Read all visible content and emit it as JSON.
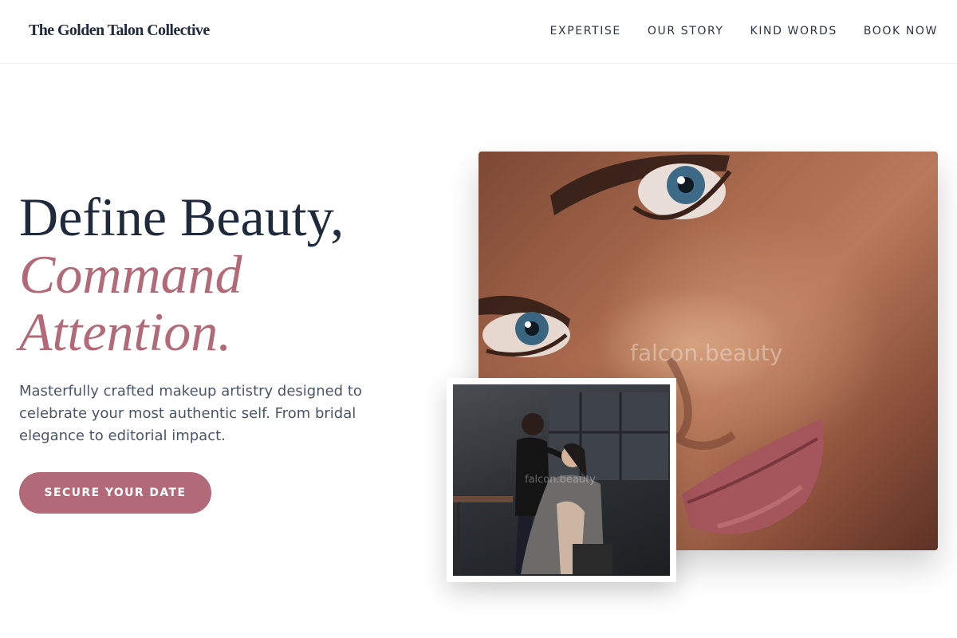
{
  "header": {
    "brand": "The Golden Talon Collective",
    "nav": [
      "EXPERTISE",
      "OUR STORY",
      "KIND WORDS",
      "BOOK NOW"
    ]
  },
  "hero": {
    "title_line1": "Define Beauty,",
    "title_line2": "Command",
    "title_line3": "Attention.",
    "subtitle": "Masterfully crafted makeup artistry designed to celebrate your most authentic self. From bridal elegance to editorial impact.",
    "cta_label": "SECURE YOUR DATE"
  },
  "images": {
    "main_watermark": "falcon.beauty",
    "inset_watermark": "falcon.beauty"
  },
  "colors": {
    "accent": "#b26a78",
    "heading": "#1f2a3c",
    "body_text": "#4a5568"
  }
}
